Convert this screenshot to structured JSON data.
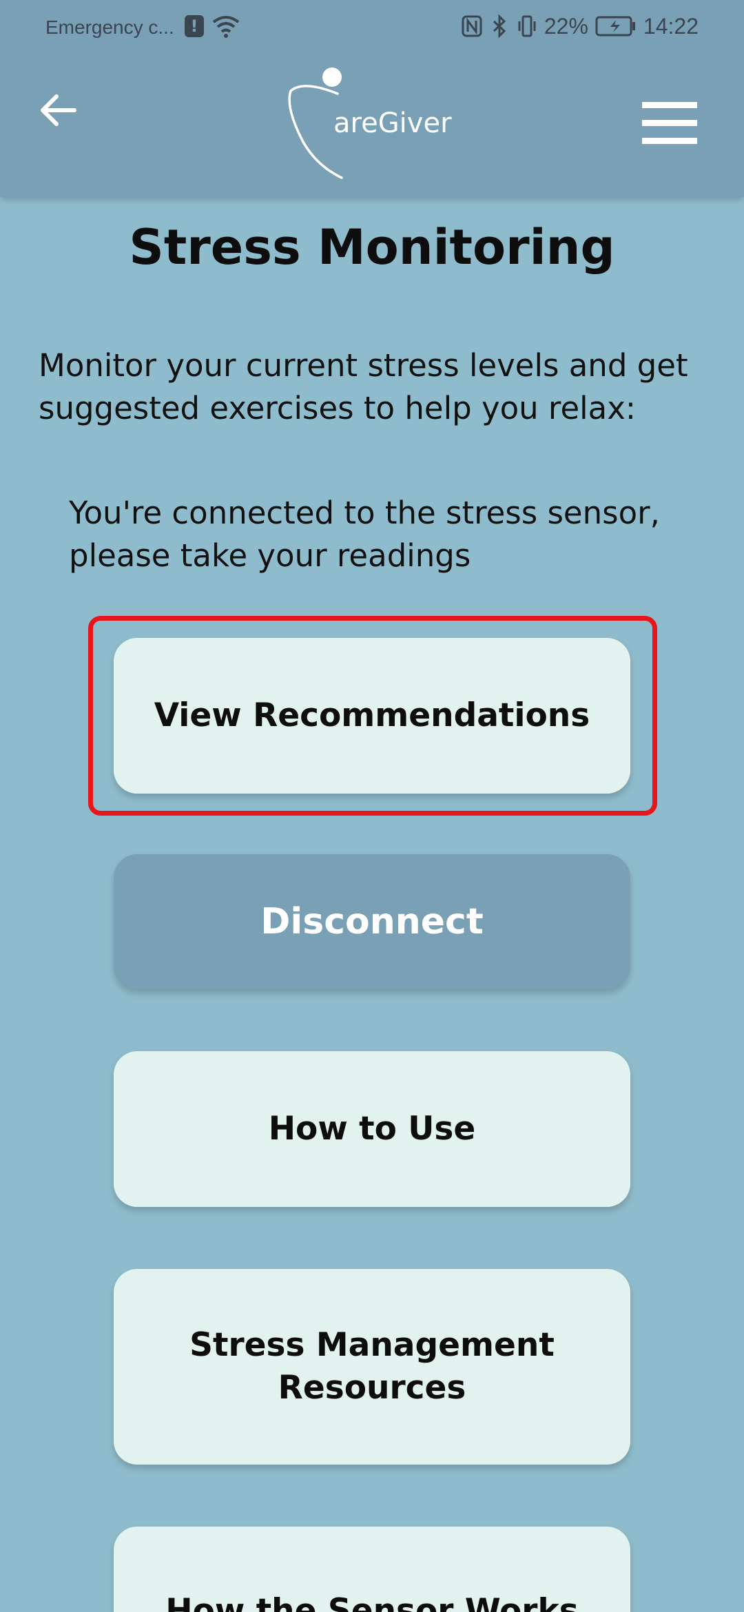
{
  "status_bar": {
    "carrier": "Emergency c...",
    "battery": "22%",
    "time": "14:22"
  },
  "header": {
    "logo_text": "areGiver"
  },
  "page": {
    "title": "Stress Monitoring",
    "intro": "Monitor your current stress levels and get suggested exercises to help you relax:",
    "connected_message": "You're connected to the stress sensor, please take your readings"
  },
  "buttons": {
    "view_recommendations": "View Recommendations",
    "disconnect": "Disconnect",
    "how_to_use": "How to Use",
    "stress_resources": "Stress Management Resources",
    "how_sensor_works": "How the Sensor Works"
  },
  "colors": {
    "header_bg": "#7aa0b5",
    "page_bg": "#8fbccc",
    "button_bg": "#e2f2ee",
    "highlight": "#e8161b"
  }
}
